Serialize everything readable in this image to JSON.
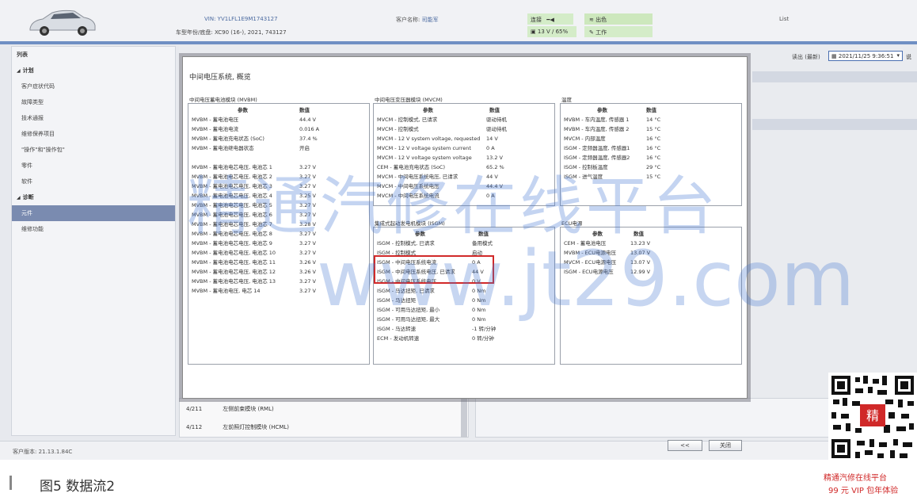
{
  "header": {
    "vin": "VIN: YV1LFL1E9M1743127",
    "model": "车型年份/底盘: XC90 (16-), 2021, 743127",
    "customer_label": "客户名称:",
    "customer_value": "司能军",
    "status_connect": "连接",
    "status_wifi": "出色",
    "status_battery": "13 V / 65%",
    "status_work": "工作",
    "list_label": "List"
  },
  "sidebar": {
    "items": [
      {
        "label": "列表",
        "kind": "hdr"
      },
      {
        "label": "计划",
        "kind": "group"
      },
      {
        "label": "客户症状代码",
        "kind": "item"
      },
      {
        "label": "故障类型",
        "kind": "item"
      },
      {
        "label": "技术通报",
        "kind": "item"
      },
      {
        "label": "维修保养项目",
        "kind": "item"
      },
      {
        "label": "\"操作\"和\"操作包\"",
        "kind": "item"
      },
      {
        "label": "零件",
        "kind": "item"
      },
      {
        "label": "软件",
        "kind": "item"
      },
      {
        "label": "诊断",
        "kind": "group"
      },
      {
        "label": "元件",
        "kind": "active"
      },
      {
        "label": "维修功能",
        "kind": "item"
      }
    ]
  },
  "right_top": {
    "read_label": "读出 (最新)",
    "date_value": "2021/11/25 9:36:51",
    "extra": "说"
  },
  "dialog": {
    "title": "中间电压系统, 概览",
    "mvbm": {
      "section_title": "中间电压蓄电池模块 (MVBM)",
      "col_param": "参数",
      "col_value": "数值",
      "rows": [
        {
          "p": "MVBM - 蓄电池电压",
          "v": "44.4 V"
        },
        {
          "p": "MVBM - 蓄电池电流",
          "v": "0.016 A"
        },
        {
          "p": "MVBM - 蓄电池充电状态 (SoC)",
          "v": "37.4 %"
        },
        {
          "p": "MVBM - 蓄电池继电器状态",
          "v": "开启"
        },
        {
          "p": "",
          "v": ""
        },
        {
          "p": "MVBM - 蓄电池电芯电压, 电池芯 1",
          "v": "3.27 V"
        },
        {
          "p": "MVBM - 蓄电池电芯电压, 电池芯 2",
          "v": "3.27 V"
        },
        {
          "p": "MVBM - 蓄电池电芯电压, 电池芯 3",
          "v": "3.27 V"
        },
        {
          "p": "MVBM - 蓄电池电芯电压, 电池芯 4",
          "v": "3.25 V"
        },
        {
          "p": "MVBM - 蓄电池电芯电压, 电池芯 5",
          "v": "3.27 V"
        },
        {
          "p": "MVBM - 蓄电池电芯电压, 电池芯 6",
          "v": "3.27 V"
        },
        {
          "p": "MVBM - 蓄电池电芯电压, 电池芯 7",
          "v": "3.28 V"
        },
        {
          "p": "MVBM - 蓄电池电芯电压, 电池芯 8",
          "v": "3.27 V"
        },
        {
          "p": "MVBM - 蓄电池电芯电压, 电池芯 9",
          "v": "3.27 V"
        },
        {
          "p": "MVBM - 蓄电池电芯电压, 电池芯 10",
          "v": "3.27 V"
        },
        {
          "p": "MVBM - 蓄电池电芯电压, 电池芯 11",
          "v": "3.26 V"
        },
        {
          "p": "MVBM - 蓄电池电芯电压, 电池芯 12",
          "v": "3.26 V"
        },
        {
          "p": "MVBM - 蓄电池电芯电压, 电池芯 13",
          "v": "3.27 V"
        },
        {
          "p": "MVBM - 蓄电池电压, 电芯 14",
          "v": "3.27 V"
        }
      ]
    },
    "mvcm": {
      "section_title": "中间电压变压器模块 (MVCM)",
      "col_param": "参数",
      "col_value": "数值",
      "rows": [
        {
          "p": "MVCM - 控制模式, 已请求",
          "v": "驱动待机"
        },
        {
          "p": "MVCM - 控制模式",
          "v": "驱动待机"
        },
        {
          "p": "MVCM - 12 V system voltage, requested",
          "v": "14 V"
        },
        {
          "p": "MVCM - 12 V voltage system current",
          "v": "0 A"
        },
        {
          "p": "MVCM - 12 V voltage system voltage",
          "v": "13.2 V"
        },
        {
          "p": "CEM - 蓄电池充电状态 (SoC)",
          "v": "65.2 %"
        },
        {
          "p": "MVCM - 中间电压系统电压, 已请求",
          "v": "44 V"
        },
        {
          "p": "MVCM - 中间电压系统电压",
          "v": "44.4 V"
        },
        {
          "p": "MVCM - 中间电压系统电流",
          "v": "0 A"
        }
      ]
    },
    "temp": {
      "section_title": "温度",
      "col_param": "参数",
      "col_value": "数值",
      "rows": [
        {
          "p": "MVBM - 车内温度, 传感器 1",
          "v": "14 °C"
        },
        {
          "p": "MVBM - 车内温度, 传感器 2",
          "v": "15 °C"
        },
        {
          "p": "MVCM - 内部温度",
          "v": "16 °C"
        },
        {
          "p": "ISGM - 定频器温度, 传感器1",
          "v": "16 °C"
        },
        {
          "p": "ISGM - 定频器温度, 传感器2",
          "v": "16 °C"
        },
        {
          "p": "ISGM - 控制板温度",
          "v": "29 °C"
        },
        {
          "p": "ISGM - 进气温度",
          "v": "15 °C"
        }
      ]
    },
    "isgm": {
      "section_title": "集成式起动发电机模块 (ISGM)",
      "col_param": "参数",
      "col_value": "数值",
      "rows": [
        {
          "p": "ISGM - 控制模式, 已请求",
          "v": "备用模式"
        },
        {
          "p": "ISGM - 控制模式",
          "v": "启动"
        },
        {
          "p": "ISGM - 中间电压系统电流",
          "v": "0 A"
        },
        {
          "p": "ISGM - 中间电压系统电压, 已请求",
          "v": "44 V"
        },
        {
          "p": "ISGM - 中间电压系统电压",
          "v": "0 V"
        },
        {
          "p": "ISGM - 马达扭矩, 已请求",
          "v": "0 Nm"
        },
        {
          "p": "ISGM - 马达扭矩",
          "v": "0 Nm"
        },
        {
          "p": "ISGM - 可用马达扭矩, 最小",
          "v": "0 Nm"
        },
        {
          "p": "ISGM - 可用马达扭矩, 最大",
          "v": "0 Nm"
        },
        {
          "p": "ISGM - 马达转速",
          "v": "-1 转/分钟"
        },
        {
          "p": "ECM - 发动机转速",
          "v": "0 转/分钟"
        }
      ]
    },
    "ecu": {
      "section_title": "ECU电源",
      "col_param": "参数",
      "col_value": "数值",
      "rows": [
        {
          "p": "CEM - 蓄电池电压",
          "v": "13.23 V"
        },
        {
          "p": "MVBM - ECU电源电压",
          "v": "13.07 V"
        },
        {
          "p": "MVCM - ECU电源电压",
          "v": "13.07 V"
        },
        {
          "p": "ISGM - ECU电源电压",
          "v": "12.99 V"
        }
      ]
    },
    "btn_back": "<<",
    "btn_close": "关闭"
  },
  "lower_list": [
    {
      "code": "4/211",
      "name": "左侧前束模块 (RML)"
    },
    {
      "code": "4/112",
      "name": "左前照灯控制模块 (HCML)"
    }
  ],
  "footer": {
    "version": "客户版本: 21.13.1.84C"
  },
  "watermark": {
    "line1": "精通汽修在线平台",
    "line2": "www.jt29.com"
  },
  "caption": "图5 数据流2",
  "qr": {
    "badge": "精",
    "line1": "精通汽修在线平台",
    "line2": "99 元 VIP 包年体验"
  },
  "colors": {
    "accent": "#6f8fc3",
    "highlight_box": "#d12a2a",
    "active_item": "#7a8bb0"
  }
}
